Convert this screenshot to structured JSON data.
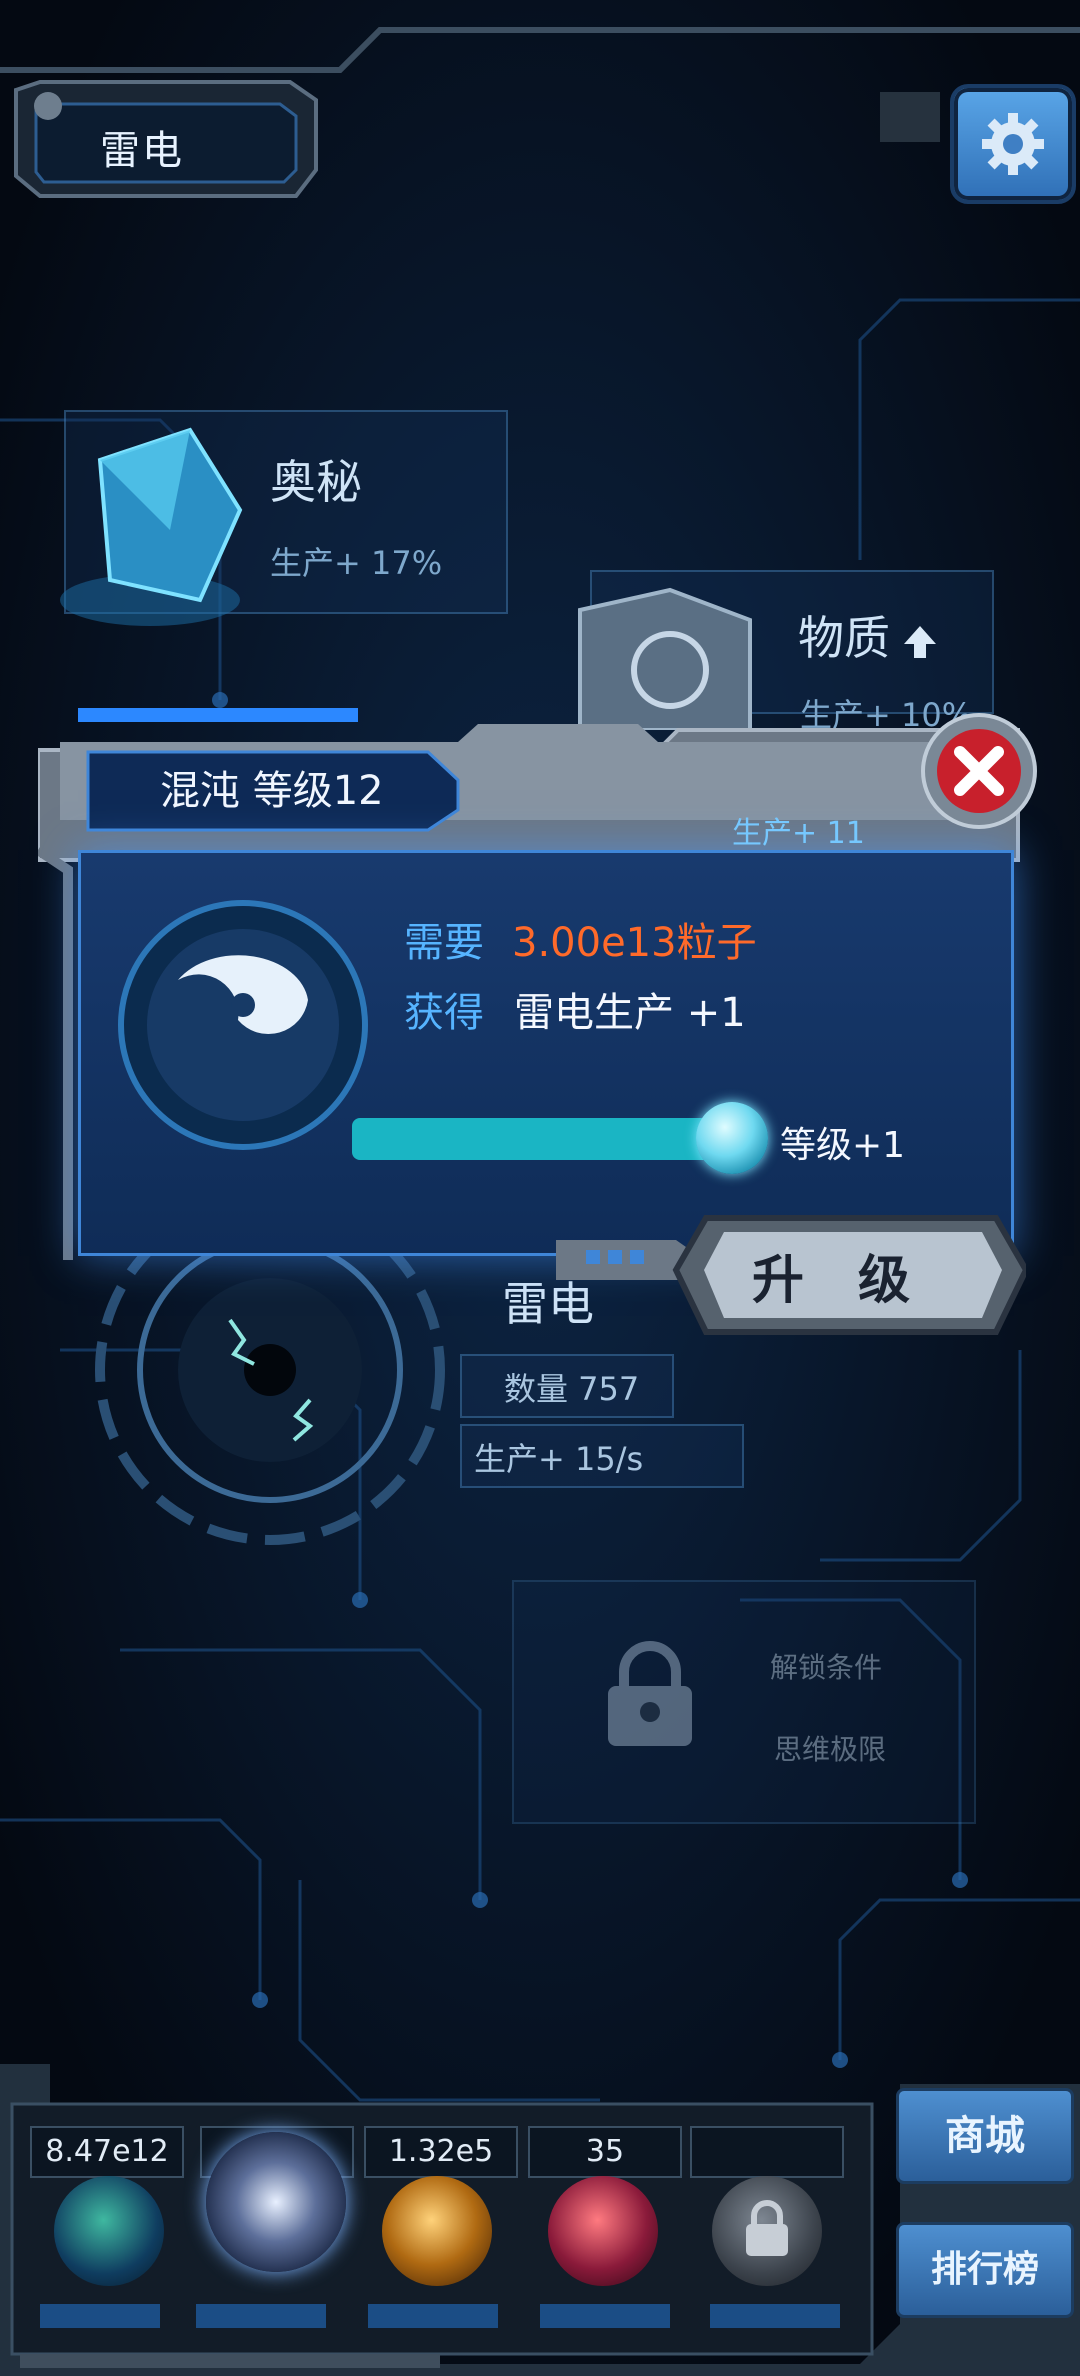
{
  "header": {
    "title": "雷电"
  },
  "cards": {
    "arcane": {
      "title": "奥秘",
      "production": "生产+ 17%"
    },
    "matter": {
      "title": "物质",
      "production": "生产+ 10%"
    },
    "thunder": {
      "title": "雷电",
      "count": "数量 757",
      "production": "生产+ 15/s"
    },
    "locked": {
      "condition_label": "解锁条件",
      "condition_value": "思维极限"
    }
  },
  "dialog": {
    "title": "混沌 等级12",
    "production": "生产+ 11",
    "require_label": "需要",
    "require_value": "3.00e13粒子",
    "gain_label": "获得",
    "gain_value": "雷电生产 +1",
    "level_delta": "等级+1",
    "level_progress": 1.0,
    "upgrade_label": "升 级"
  },
  "bottom": {
    "resources": [
      "8.47e12",
      "",
      "1.32e5",
      "35",
      ""
    ],
    "shop_label": "商城",
    "ranking_label": "排行榜"
  },
  "colors": {
    "accent": "#3f86d8",
    "highlight": "#ff6a2a",
    "bar": "#1ab5c4"
  }
}
